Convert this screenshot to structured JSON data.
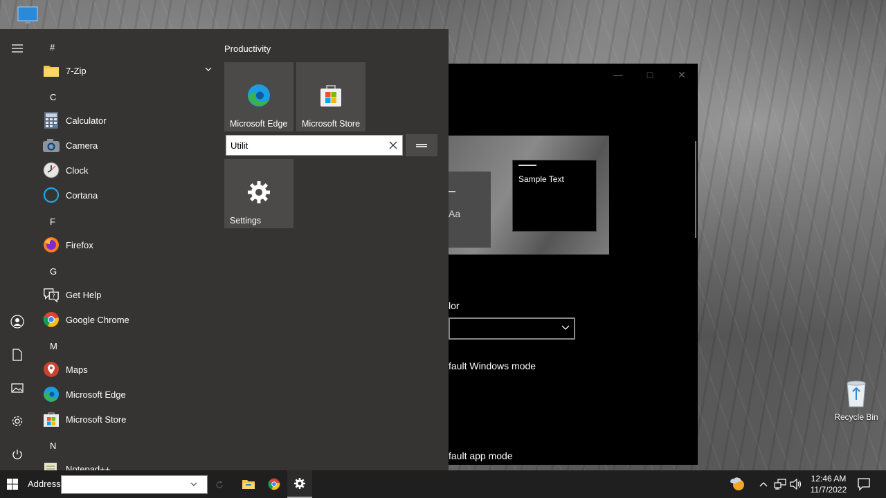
{
  "desktop": {
    "recycle_bin_label": "Recycle Bin"
  },
  "settings_window": {
    "preview_aa": "Aa",
    "preview_sample_text": "Sample Text",
    "label_color": "lor",
    "label_windows_mode": "fault Windows mode",
    "label_app_mode": "fault app mode"
  },
  "start_menu": {
    "app_list": [
      {
        "type": "letter",
        "text": "#"
      },
      {
        "type": "app",
        "name": "7-Zip",
        "icon": "folder-icon",
        "expandable": true
      },
      {
        "type": "letter",
        "text": "C"
      },
      {
        "type": "app",
        "name": "Calculator",
        "icon": "calculator-icon"
      },
      {
        "type": "app",
        "name": "Camera",
        "icon": "camera-icon"
      },
      {
        "type": "app",
        "name": "Clock",
        "icon": "clock-icon"
      },
      {
        "type": "app",
        "name": "Cortana",
        "icon": "cortana-icon"
      },
      {
        "type": "letter",
        "text": "F"
      },
      {
        "type": "app",
        "name": "Firefox",
        "icon": "firefox-icon"
      },
      {
        "type": "letter",
        "text": "G"
      },
      {
        "type": "app",
        "name": "Get Help",
        "icon": "get-help-icon"
      },
      {
        "type": "app",
        "name": "Google Chrome",
        "icon": "chrome-icon"
      },
      {
        "type": "letter",
        "text": "M"
      },
      {
        "type": "app",
        "name": "Maps",
        "icon": "maps-icon"
      },
      {
        "type": "app",
        "name": "Microsoft Edge",
        "icon": "edge-icon"
      },
      {
        "type": "app",
        "name": "Microsoft Store",
        "icon": "store-icon"
      },
      {
        "type": "letter",
        "text": "N"
      },
      {
        "type": "app",
        "name": "Notepad++",
        "icon": "notepad-icon"
      }
    ],
    "tiles": {
      "group_title": "Productivity",
      "edge_tile_label": "Microsoft Edge",
      "store_tile_label": "Microsoft Store",
      "group_name_input_value": "Utilit",
      "settings_tile_label": "Settings"
    },
    "rail_icons": [
      "hamburger-icon",
      "user-icon",
      "document-icon",
      "pictures-icon",
      "settings-icon",
      "power-icon"
    ]
  },
  "taskbar": {
    "address_label": "Address",
    "address_value": "",
    "clock_time": "12:46 AM",
    "clock_date": "11/7/2022"
  },
  "colors": {
    "start_bg": "#353432",
    "tile_bg": "#4b4a48",
    "taskbar_bg": "#1f1f1f",
    "edge_blue": "#1b9de2",
    "edge_green": "#3bb34a"
  }
}
